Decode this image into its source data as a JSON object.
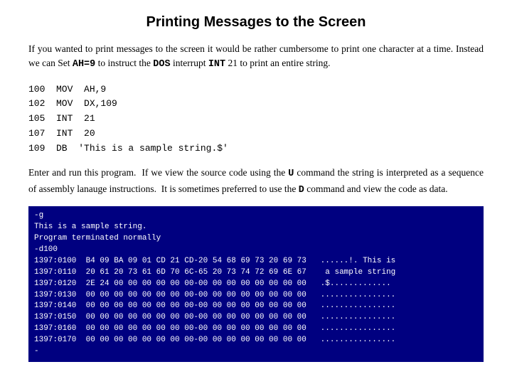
{
  "page": {
    "title": "Printing Messages to the Screen",
    "intro": "If you wanted to print messages to the screen it would be rather cumbersome to print one character at a time. Instead we can Set AH=9 to instruct the DOS interrupt INT 21 to print an entire string.",
    "code_lines": [
      "100  MOV  AH,9",
      "102  MOV  DX,109",
      "105  INT  21",
      "107  INT  20",
      "109  DB  'This is a sample string.$'"
    ],
    "body_text": "Enter and run this program.  If we view the source code using the U command the string is interpreted as a sequence of assembly lanauge instructions.  It is sometimes preferred to use the D command and view the code as data.",
    "terminal": {
      "lines": [
        "-g",
        "This is a sample string.",
        "Program terminated normally",
        "-d100",
        "1397:0100  B4 09 BA 09 01 CD 21 CD-20 54 68 69 73 20 69 73   ......!. This is",
        "1397:0110  20 61 20 73 61 6D 70 6C-65 20 73 74 72 69 6E 67    a sample string",
        "1397:0120  2E 24 00 00 00 00 00 00-00 00 00 00 00 00 00 00   .$.............",
        "1397:0130  00 00 00 00 00 00 00 00-00 00 00 00 00 00 00 00   ................",
        "1397:0140  00 00 00 00 00 00 00 00-00 00 00 00 00 00 00 00   ................",
        "1397:0150  00 00 00 00 00 00 00 00-00 00 00 00 00 00 00 00   ................",
        "1397:0160  00 00 00 00 00 00 00 00-00 00 00 00 00 00 00 00   ................",
        "1397:0170  00 00 00 00 00 00 00 00-00 00 00 00 00 00 00 00   ................",
        "-"
      ]
    }
  }
}
